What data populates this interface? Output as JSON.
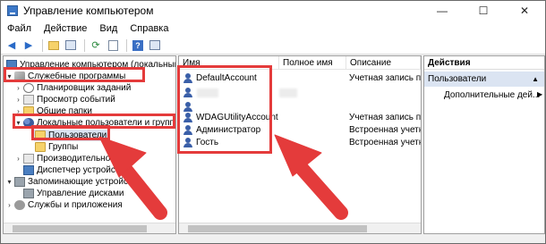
{
  "window": {
    "title": "Управление компьютером",
    "controls": {
      "minimize": "—",
      "maximize": "☐",
      "close": "✕"
    }
  },
  "menu": [
    "Файл",
    "Действие",
    "Вид",
    "Справка"
  ],
  "toolbar": [
    "back-icon",
    "forward-icon",
    "up-icon",
    "console-tree-icon",
    "refresh-icon",
    "export-icon",
    "help-icon",
    "properties-icon"
  ],
  "tree": {
    "items": [
      {
        "label": "Управление компьютером (локальным)",
        "expander": "",
        "icon": "computer-management-icon"
      },
      {
        "label": "Служебные программы",
        "expander": "▾",
        "icon": "tools-icon"
      },
      {
        "label": "Планировщик заданий",
        "expander": "›",
        "icon": "clock-icon"
      },
      {
        "label": "Просмотр событий",
        "expander": "›",
        "icon": "event-viewer-icon"
      },
      {
        "label": "Общие папки",
        "expander": "›",
        "icon": "shared-folder-icon"
      },
      {
        "label": "Локальные пользователи и группы",
        "expander": "▾",
        "icon": "users-icon"
      },
      {
        "label": "Пользователи",
        "expander": "",
        "icon": "folder-icon"
      },
      {
        "label": "Группы",
        "expander": "",
        "icon": "folder-icon"
      },
      {
        "label": "Производительность",
        "expander": "›",
        "icon": "performance-icon"
      },
      {
        "label": "Диспетчер устройств",
        "expander": "",
        "icon": "device-manager-icon"
      },
      {
        "label": "Запоминающие устройства",
        "expander": "▾",
        "icon": "storage-icon"
      },
      {
        "label": "Управление дисками",
        "expander": "",
        "icon": "disk-icon"
      },
      {
        "label": "Службы и приложения",
        "expander": "›",
        "icon": "services-icon"
      }
    ]
  },
  "list": {
    "columns": [
      "Имя",
      "Полное имя",
      "Описание"
    ],
    "rows": [
      {
        "name": "DefaultAccount",
        "full": "",
        "desc": "Учетная запись поль..."
      },
      {
        "name": "",
        "full": "",
        "desc": ""
      },
      {
        "name": "",
        "full": "",
        "desc": ""
      },
      {
        "name": "WDAGUtilityAccount",
        "full": "",
        "desc": "Учетная запись поль..."
      },
      {
        "name": "Администратор",
        "full": "",
        "desc": "Встроенная учетная..."
      },
      {
        "name": "Гость",
        "full": "",
        "desc": "Встроенная учетная..."
      }
    ]
  },
  "actions": {
    "header": "Действия",
    "selected": "Пользователи",
    "item": "Дополнительные дей...",
    "item_arrow": "▶"
  },
  "highlight_color": "#e43b3b"
}
